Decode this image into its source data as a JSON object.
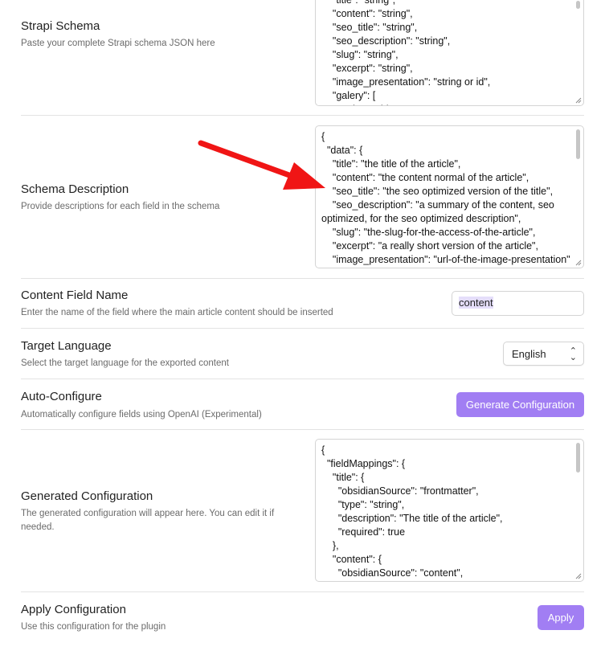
{
  "settings": {
    "strapi_schema": {
      "name": "Strapi Schema",
      "desc": "Paste your complete Strapi schema JSON here",
      "value": "    \"title\": \"string\",\n    \"content\": \"string\",\n    \"seo_title\": \"string\",\n    \"seo_description\": \"string\",\n    \"slug\": \"string\",\n    \"excerpt\": \"string\",\n    \"image_presentation\": \"string or id\",\n    \"galery\": [\n      \"string or id\""
    },
    "schema_description": {
      "name": "Schema Description",
      "desc": "Provide descriptions for each field in the schema",
      "value": "{\n  \"data\": {\n    \"title\": \"the title of the article\",\n    \"content\": \"the content normal of the article\",\n    \"seo_title\": \"the seo optimized version of the title\",\n    \"seo_description\": \"a summary of the content, seo optimized, for the seo optimized description\",\n    \"slug\": \"the-slug-for-the-access-of-the-article\",\n    \"excerpt\": \"a really short version of the article\",\n    \"image_presentation\": \"url-of-the-image-presentation\""
    },
    "content_field": {
      "name": "Content Field Name",
      "desc": "Enter the name of the field where the main article content should be inserted",
      "value": "content"
    },
    "target_language": {
      "name": "Target Language",
      "desc": "Select the target language for the exported content",
      "selected": "English"
    },
    "auto_configure": {
      "name": "Auto-Configure",
      "desc": "Automatically configure fields using OpenAI (Experimental)",
      "button": "Generate Configuration"
    },
    "generated_configuration": {
      "name": "Generated Configuration",
      "desc": "The generated configuration will appear here. You can edit it if needed.",
      "value": "{\n  \"fieldMappings\": {\n    \"title\": {\n      \"obsidianSource\": \"frontmatter\",\n      \"type\": \"string\",\n      \"description\": \"The title of the article\",\n      \"required\": true\n    },\n    \"content\": {\n      \"obsidianSource\": \"content\",\n      \"type\": \"string\""
    },
    "apply_configuration": {
      "name": "Apply Configuration",
      "desc": "Use this configuration for the plugin",
      "button": "Apply"
    }
  },
  "colors": {
    "accent": "#a17ef3",
    "annotation_arrow": "#f01515"
  }
}
